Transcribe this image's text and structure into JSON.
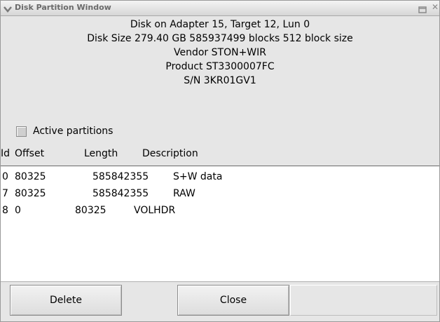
{
  "window": {
    "title": "Disk Partition Window",
    "close_glyph": "✕",
    "icons": [
      "chevron-down-icon",
      "maximize-icon",
      "close-icon"
    ]
  },
  "disk_info": {
    "line1": "Disk on Adapter 15, Target 12, Lun 0",
    "line2": "Disk Size 279.40 GB  585937499 blocks  512 block size",
    "line3": "Vendor STON+WIR",
    "line4": "Product ST3300007FC",
    "line5": "S/N 3KR01GV1"
  },
  "active_partitions": {
    "label": "Active partitions",
    "checked": false
  },
  "table": {
    "headers": {
      "id": "Id",
      "offset": "Offset",
      "length": "Length",
      "description": "Description"
    },
    "rows": [
      {
        "id": "0",
        "offset": "80325",
        "length": "585842355",
        "description": "S+W data"
      },
      {
        "id": "7",
        "offset": "80325",
        "length": "585842355",
        "description": "RAW"
      },
      {
        "id": "8",
        "offset": "0",
        "length": "80325",
        "description": "VOLHDR"
      }
    ]
  },
  "buttons": {
    "delete": "Delete",
    "close": "Close"
  }
}
